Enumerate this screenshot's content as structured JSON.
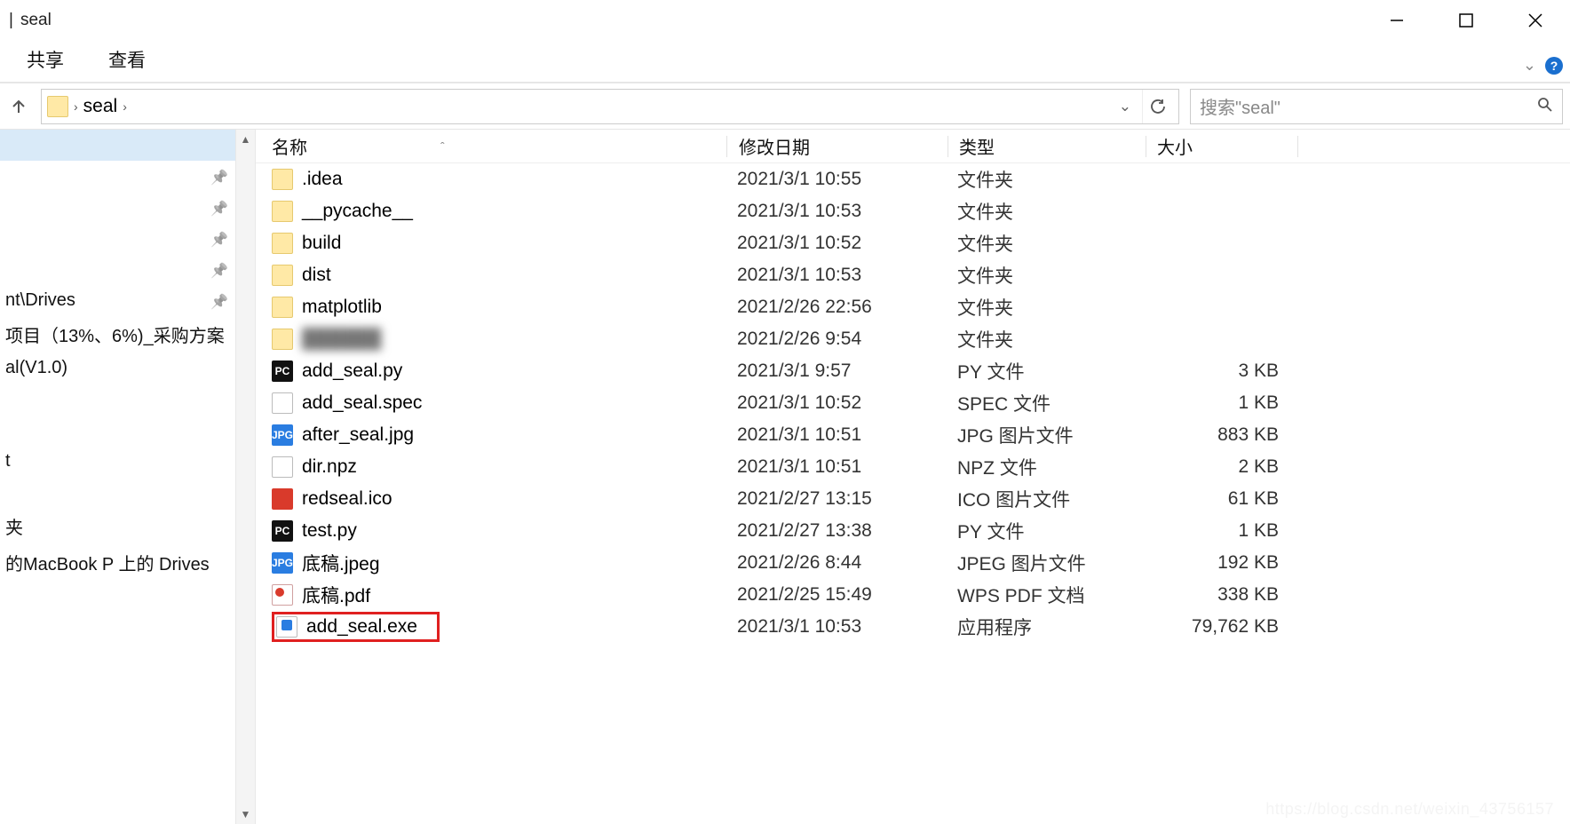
{
  "title": {
    "separator": "|",
    "text": "seal"
  },
  "ribbon": {
    "tabs": [
      "共享",
      "查看"
    ]
  },
  "address": {
    "current": "seal",
    "separator": "›"
  },
  "search": {
    "placeholder": "搜索\"seal\""
  },
  "columns": {
    "name": "名称",
    "date": "修改日期",
    "type": "类型",
    "size": "大小"
  },
  "sidebar": {
    "items": [
      {
        "label": "",
        "selected": true
      },
      {
        "label": ""
      },
      {
        "label": ""
      },
      {
        "label": ""
      },
      {
        "label": ""
      },
      {
        "label": "nt\\Drives"
      },
      {
        "label": "项目（13%、6%)_采购方案"
      },
      {
        "label": "al(V1.0)"
      },
      {
        "label": ""
      },
      {
        "label": ""
      },
      {
        "label": "t"
      },
      {
        "label": ""
      },
      {
        "label": "夹"
      },
      {
        "label": "的MacBook P 上的 Drives"
      }
    ]
  },
  "files": [
    {
      "icon": "folder",
      "name": ".idea",
      "date": "2021/3/1 10:55",
      "type": "文件夹",
      "size": "",
      "blurred": false
    },
    {
      "icon": "folder",
      "name": "__pycache__",
      "date": "2021/3/1 10:53",
      "type": "文件夹",
      "size": "",
      "blurred": false
    },
    {
      "icon": "folder",
      "name": "build",
      "date": "2021/3/1 10:52",
      "type": "文件夹",
      "size": "",
      "blurred": false
    },
    {
      "icon": "folder",
      "name": "dist",
      "date": "2021/3/1 10:53",
      "type": "文件夹",
      "size": "",
      "blurred": false
    },
    {
      "icon": "folder",
      "name": "matplotlib",
      "date": "2021/2/26 22:56",
      "type": "文件夹",
      "size": "",
      "blurred": false
    },
    {
      "icon": "folder",
      "name": "██████",
      "date": "2021/2/26 9:54",
      "type": "文件夹",
      "size": "",
      "blurred": true
    },
    {
      "icon": "py",
      "name": "add_seal.py",
      "date": "2021/3/1 9:57",
      "type": "PY 文件",
      "size": "3 KB",
      "blurred": false
    },
    {
      "icon": "blank",
      "name": "add_seal.spec",
      "date": "2021/3/1 10:52",
      "type": "SPEC 文件",
      "size": "1 KB",
      "blurred": false
    },
    {
      "icon": "jpg",
      "name": "after_seal.jpg",
      "date": "2021/3/1 10:51",
      "type": "JPG 图片文件",
      "size": "883 KB",
      "blurred": false
    },
    {
      "icon": "blank",
      "name": "dir.npz",
      "date": "2021/3/1 10:51",
      "type": "NPZ 文件",
      "size": "2 KB",
      "blurred": false
    },
    {
      "icon": "ico",
      "name": "redseal.ico",
      "date": "2021/2/27 13:15",
      "type": "ICO 图片文件",
      "size": "61 KB",
      "blurred": false
    },
    {
      "icon": "py",
      "name": "test.py",
      "date": "2021/2/27 13:38",
      "type": "PY 文件",
      "size": "1 KB",
      "blurred": false
    },
    {
      "icon": "jpg",
      "name": "底稿.jpeg",
      "date": "2021/2/26 8:44",
      "type": "JPEG 图片文件",
      "size": "192 KB",
      "blurred": false
    },
    {
      "icon": "pdf",
      "name": "底稿.pdf",
      "date": "2021/2/25 15:49",
      "type": "WPS PDF 文档",
      "size": "338 KB",
      "blurred": false
    },
    {
      "icon": "exe",
      "name": "add_seal.exe",
      "date": "2021/3/1 10:53",
      "type": "应用程序",
      "size": "79,762 KB",
      "blurred": false,
      "highlighted": true
    }
  ],
  "icon_labels": {
    "py": "PC",
    "jpg": "JPG"
  },
  "watermark": "https://blog.csdn.net/weixin_43756157"
}
